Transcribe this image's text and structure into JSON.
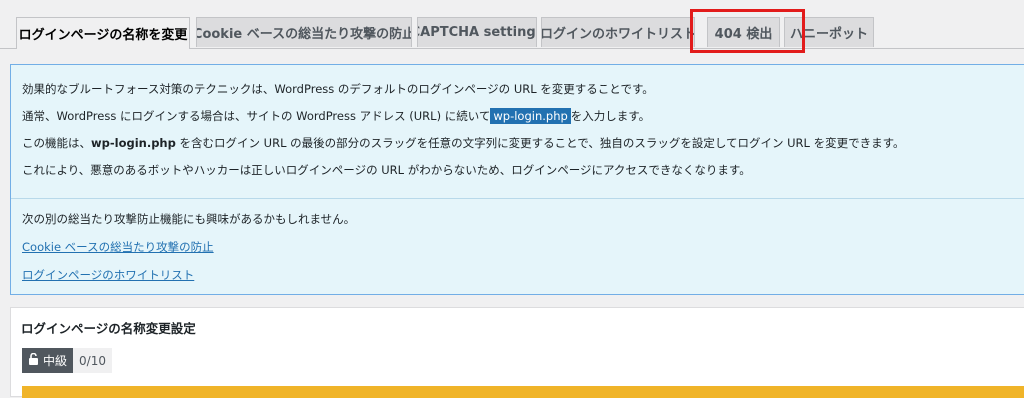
{
  "tabs": [
    {
      "label": "ログインページの名称を変更",
      "active": true
    },
    {
      "label": "Cookie ベースの総当たり攻撃の防止",
      "active": false
    },
    {
      "label": "CAPTCHA settings",
      "active": false
    },
    {
      "label": "ログインのホワイトリスト",
      "active": false
    },
    {
      "label": "404 検出",
      "active": false
    },
    {
      "label": "ハニーポット",
      "active": false
    }
  ],
  "info": {
    "line1": "効果的なブルートフォース対策のテクニックは、WordPress のデフォルトのログインページの URL を変更することです。",
    "line2_pre": "通常、WordPress にログインする場合は、サイトの WordPress アドレス (URL) に続いて",
    "line2_code": "wp-login.php",
    "line2_post": "を入力します。",
    "line3_pre": "この機能は、",
    "line3_bold": "wp-login.php",
    "line3_post": " を含むログイン URL の最後の部分のスラッグを任意の文字列に変更することで、独自のスラッグを設定してログイン URL を変更できます。",
    "line4": "これにより、悪意のあるボットやハッカーは正しいログインページの URL がわからないため、ログインページにアクセスできなくなります。",
    "related_intro": "次の別の総当たり攻撃防止機能にも興味があるかもしれません。",
    "link1": "Cookie ベースの総当たり攻撃の防止",
    "link2": "ログインページのホワイトリスト"
  },
  "panel": {
    "title": "ログインページの名称変更設定",
    "level_label": "中級",
    "score": "0/10"
  },
  "colors": {
    "highlight_border": "#e21b1b",
    "info_bg": "#e5f5fa",
    "link": "#2271b1",
    "warning": "#f0b429"
  }
}
